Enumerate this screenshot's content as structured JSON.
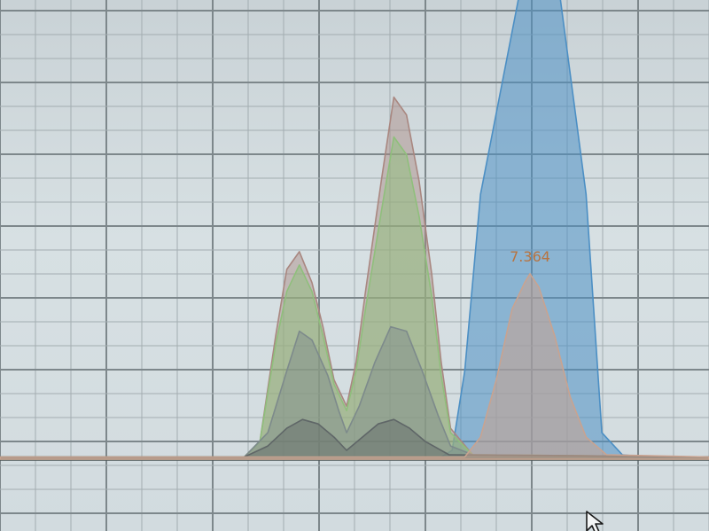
{
  "chart_data": {
    "type": "area",
    "title": "",
    "xlabel": "",
    "ylabel": "",
    "xlim": [
      4.0,
      8.5
    ],
    "ylim": [
      0,
      100
    ],
    "grid": true,
    "series": [
      {
        "color": "#4c8fc4",
        "x": [
          4.0,
          6.8,
          6.87,
          6.95,
          7.05,
          7.3,
          7.55,
          7.72,
          7.82,
          7.95,
          8.1,
          8.5
        ],
        "y": [
          0.5,
          0.5,
          2,
          20,
          60,
          106,
          106,
          60,
          6,
          1,
          0.5,
          0.5
        ]
      },
      {
        "color": "#a98780",
        "x": [
          4.0,
          5.55,
          5.65,
          5.75,
          5.82,
          5.9,
          5.98,
          6.05,
          6.12,
          6.2,
          6.26,
          6.32,
          6.42,
          6.5,
          6.58,
          6.66,
          6.74,
          6.8,
          6.86,
          7.0,
          8.5
        ],
        "y": [
          0.5,
          0.5,
          4,
          28,
          43,
          47,
          40,
          30,
          18,
          12,
          22,
          38,
          63,
          82,
          78,
          63,
          42,
          22,
          7,
          1,
          0.5
        ]
      },
      {
        "color": "#8fbf7c",
        "x": [
          4.0,
          5.55,
          5.65,
          5.75,
          5.82,
          5.9,
          5.98,
          6.05,
          6.12,
          6.2,
          6.26,
          6.32,
          6.42,
          6.5,
          6.58,
          6.66,
          6.74,
          6.8,
          6.86,
          7.0,
          8.5
        ],
        "y": [
          0.5,
          0.5,
          4,
          26,
          38,
          44,
          38,
          28,
          17,
          11,
          20,
          34,
          56,
          73,
          69,
          55,
          37,
          19,
          6,
          1,
          0.5
        ]
      },
      {
        "color": "#7d8a8b",
        "x": [
          4.0,
          5.55,
          5.7,
          5.82,
          5.9,
          5.98,
          6.08,
          6.15,
          6.2,
          6.28,
          6.38,
          6.48,
          6.58,
          6.68,
          6.78,
          6.86,
          7.0,
          8.5
        ],
        "y": [
          0.5,
          0.5,
          6,
          20,
          29,
          27,
          19,
          11,
          6,
          12,
          22,
          30,
          29,
          20,
          10,
          3,
          1,
          0.5
        ]
      },
      {
        "color": "#5f6667",
        "x": [
          4.0,
          5.55,
          5.7,
          5.82,
          5.92,
          6.02,
          6.12,
          6.2,
          6.3,
          6.4,
          6.5,
          6.6,
          6.7,
          6.85,
          8.5
        ],
        "y": [
          0.5,
          0.5,
          3,
          7,
          9,
          8,
          5,
          2,
          5,
          8,
          9,
          7,
          4,
          1,
          0.5
        ]
      },
      {
        "color": "#c9a390",
        "x": [
          4.0,
          6.95,
          7.05,
          7.15,
          7.25,
          7.33,
          7.364,
          7.42,
          7.52,
          7.62,
          7.72,
          7.85,
          8.5
        ],
        "y": [
          0.5,
          0.5,
          5,
          18,
          34,
          40,
          42,
          39,
          28,
          14,
          5,
          1,
          0.5
        ]
      }
    ],
    "annotations": [
      {
        "text": "7.364",
        "x": 7.364,
        "y": 42
      }
    ]
  },
  "ui": {
    "cursor_icon": "mouse-pointer-arrow-icon"
  }
}
